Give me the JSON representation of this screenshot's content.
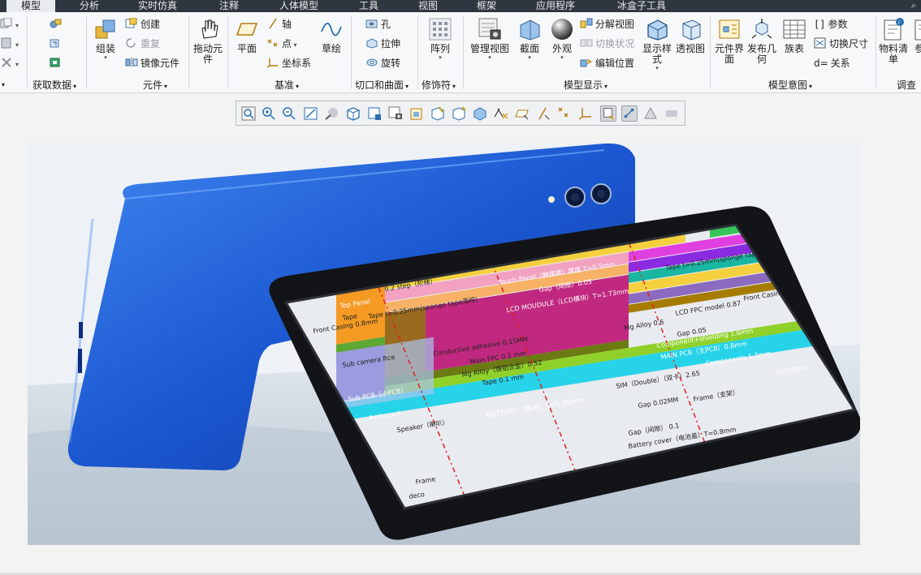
{
  "tabs": [
    {
      "label": "模型",
      "active": true
    },
    {
      "label": "分析"
    },
    {
      "label": "实时仿真"
    },
    {
      "label": "注释"
    },
    {
      "label": "人体模型"
    },
    {
      "label": "工具"
    },
    {
      "label": "视图"
    },
    {
      "label": "框架"
    },
    {
      "label": "应用程序"
    },
    {
      "label": "冰盒子工具"
    }
  ],
  "ribbon": {
    "groups": {
      "get_data": "获取数据",
      "components": "元件",
      "datum": "基准",
      "cut_surface": "切口和曲面",
      "modifiers": "修饰符",
      "model_display": "模型显示",
      "model_intent": "模型意图",
      "investigate": "调查"
    },
    "buttons": {
      "assemble": "组装",
      "create": "创建",
      "repeat": "重复",
      "mirror_component": "镜像元件",
      "drag_component": "拖动元件",
      "plane": "平面",
      "axis": "轴",
      "point": "点",
      "csys": "坐标系",
      "sketch": "草绘",
      "hole": "孔",
      "extrude": "拉伸",
      "revolve": "旋转",
      "pattern": "阵列",
      "manage_views": "管理视图",
      "section": "截面",
      "appearance": "外观",
      "explode_view": "分解视图",
      "toggle_status": "切换状况",
      "edit_position": "编辑位置",
      "display_style": "显示样式",
      "perspective": "透视图",
      "component_interface": "元件界面",
      "publish_geometry": "发布几何",
      "family_table": "族表",
      "parameters": "参数",
      "switch_dimensions": "切换尺寸",
      "relations": "关系",
      "bom": "物料清单",
      "ref_viewer": "参考"
    }
  },
  "viewport": {
    "overlay_labels": {
      "step": "0.2 step（阶梯）",
      "touch_panel": "Touch Panel（触摸屏）厚度 T=0.5mm",
      "tape_top": "Tape t=0.25mm(sponge tape海绵)",
      "top_panel": "Top Panel",
      "gap_005": "Gap（间隙）0.05",
      "tape_left": "Tape",
      "tape_sponge": "Tape t=0.25mm(sponge tape海绵)",
      "lcd_module": "LCD MOUDULE（LCD模块）T=1.73mm",
      "lcd_fpc": "LCD FPC model 0.87",
      "front_casing_right": "Front Casing（前壳）",
      "front_casing_left": "Front Casing 0.8mm",
      "mg_alloy_right": "Mg Alloy 0.6",
      "gap_005b": "Gap 0.05",
      "conductive": "Conductive adhesive 0.15MM",
      "component_shield": "Component+shielding 1.6mm",
      "main_fpc": "Main FPC 0.2 mm",
      "main_pcb": "MAIN PCB（主PCB）0.8mm",
      "sub_camera": "Sub camera Rce",
      "mg_alloy": "Mg Alloy（镁铝合金）0.52",
      "components": "Components 1.7mm",
      "tape_01": "Tape 0.1 mm",
      "antenna": "ANTENNA",
      "sim": "SIM（Double）（双卡）2.65",
      "gap_002": "Gap 0.02MM",
      "frame_top": "Frame（支架）",
      "sub_pcb": "Sub PCB（小PCB）",
      "battery": "BATTERY（电池）t=5.95mm",
      "audio_jack": "Audio jack",
      "speaker": "Speaker（喇叭）",
      "gap_01": "Gap（间隙） 0.1",
      "battery_cover": "Battery cover（电池盖）T=0.8mm",
      "frame": "Frame",
      "deco": "deco"
    }
  },
  "colors": {
    "tab_bar": "#2f3640",
    "ribbon_bg": "#f7f8fa",
    "phone_back_blue": "#1e5fd6",
    "battery_magenta": "#c0297f",
    "lcd_blue": "#3b82e6",
    "cyan": "#27d3e8",
    "lime": "#8fd12a"
  }
}
